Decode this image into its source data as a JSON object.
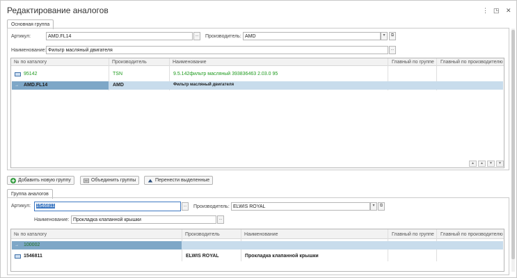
{
  "window": {
    "title": "Редактирование аналогов",
    "menu_icon": "⋮",
    "restore_icon": "◳",
    "close_icon": "✕"
  },
  "main_group": {
    "tab_label": "Основная группа",
    "article_label": "Артикул:",
    "article_value": "AMD.FL14",
    "manufacturer_label": "Производитель:",
    "manufacturer_value": "AMD",
    "name_label": "Наименование:",
    "name_value": "Фильтр масляный двигателя",
    "columns": [
      "№ по каталогу",
      "Производитель",
      "Наименование",
      "Главный по группе",
      "Главный по производителю"
    ],
    "rows": [
      {
        "catalog": "95142",
        "manufacturer": "TSN",
        "name": "9.5.142фильтр масляный 393836463 2.03.0 95"
      },
      {
        "catalog": "AMD.FL14",
        "manufacturer": "AMD",
        "name": "Фильтр масляный двигателя"
      }
    ]
  },
  "actions": {
    "add_group": "Добавить новую группу",
    "merge_groups": "Объединить группы",
    "move_selected": "Перенести выделенные"
  },
  "analog_group": {
    "tab_label": "Группа аналогов",
    "article_label": "Артикул:",
    "article_value": "1546811",
    "manufacturer_label": "Производитель:",
    "manufacturer_value": "ELWIS ROYAL",
    "name_label": "Наименование:",
    "name_value": "Прокладка клапанной крышки",
    "columns": [
      "№ по каталогу",
      "Производитель",
      "Наименование",
      "Главный по группе",
      "Главный по производителю"
    ],
    "rows": [
      {
        "catalog": "100002",
        "manufacturer": "",
        "name": ""
      },
      {
        "catalog": "1546811",
        "manufacturer": "ELWIS ROYAL",
        "name": "Прокладка клапанной крышки"
      }
    ]
  },
  "icons": {
    "ellipsis": "...",
    "dropdown": "▾",
    "link": "⧉"
  },
  "colors": {
    "selected_row": "#c8dcec",
    "selected_cell_dark": "#7ea7c7",
    "green_text": "#1d9a1d",
    "focus_border": "#3d78c2"
  }
}
